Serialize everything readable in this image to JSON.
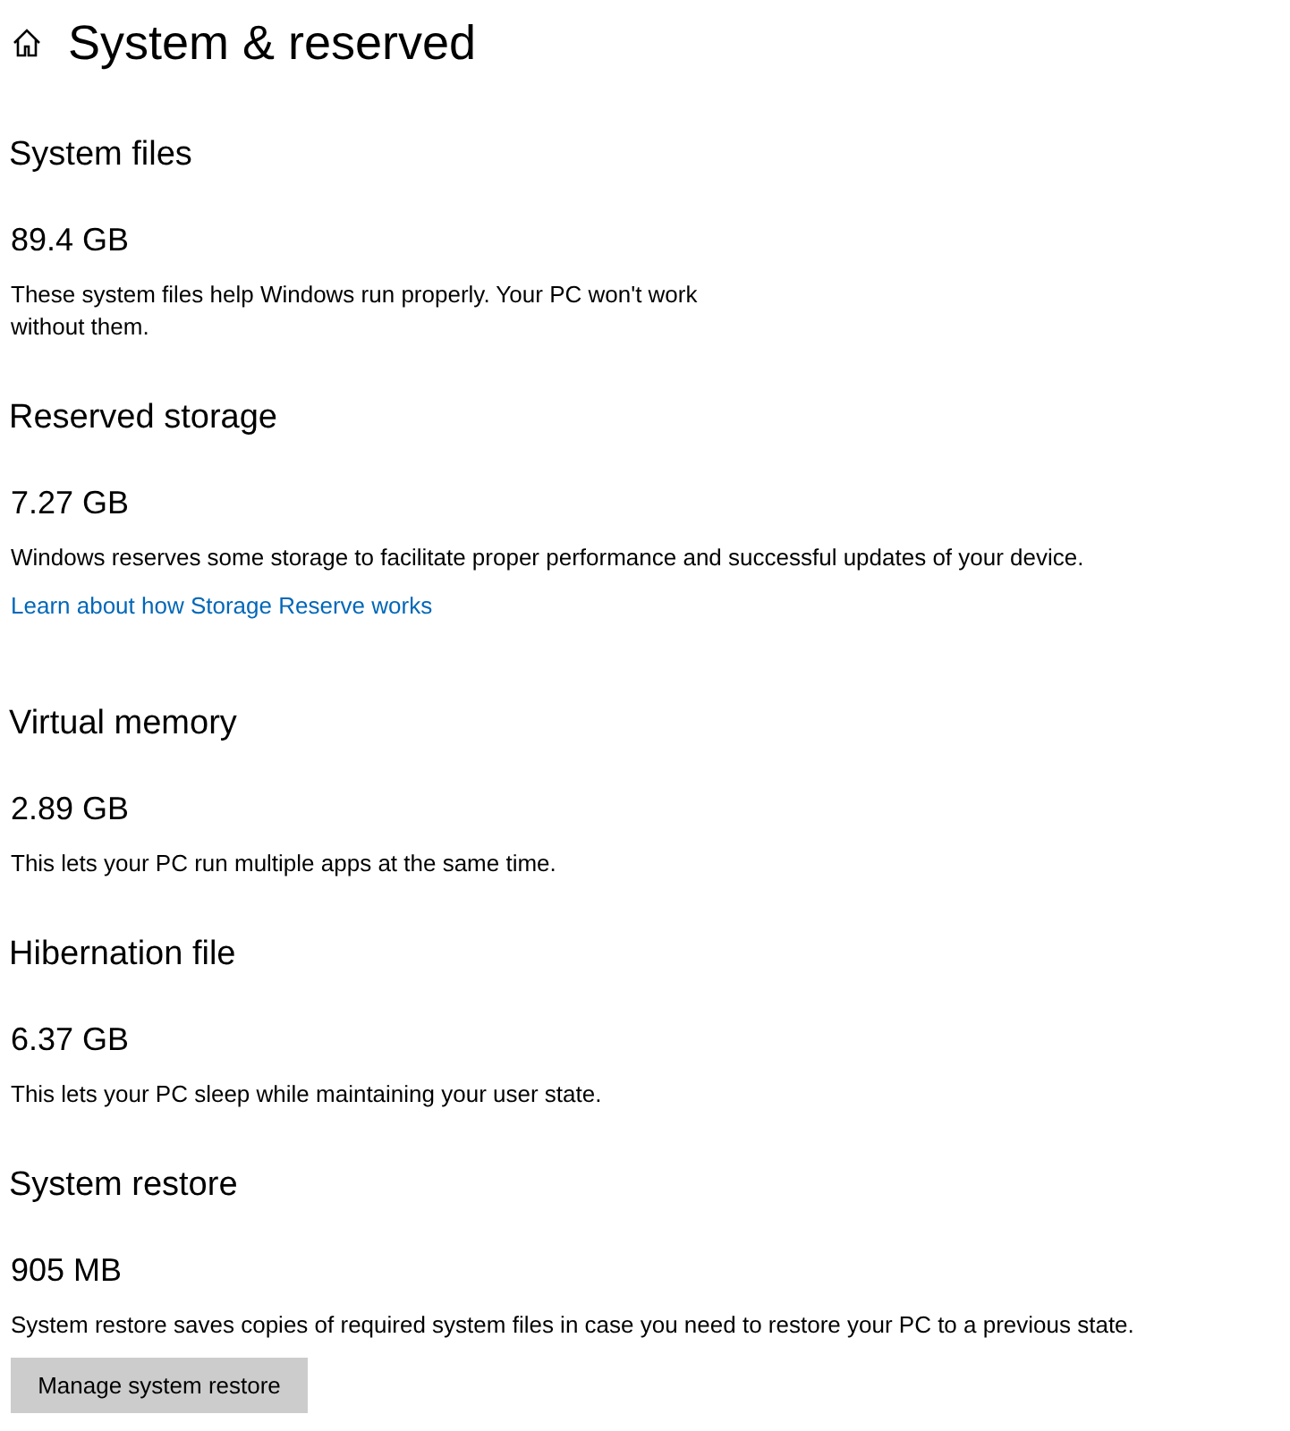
{
  "header": {
    "title": "System & reserved"
  },
  "sections": [
    {
      "heading": "System files",
      "size": "89.4 GB",
      "description": [
        "These system files help Windows run properly. Your PC won't work",
        "without them."
      ]
    },
    {
      "heading": "Reserved storage",
      "size": "7.27 GB",
      "description": [
        "Windows reserves some storage to facilitate proper performance and successful updates of your device."
      ],
      "link": "Learn about how Storage Reserve works"
    },
    {
      "heading": "Virtual memory",
      "size": "2.89 GB",
      "description": [
        "This lets your PC run multiple apps at the same time."
      ]
    },
    {
      "heading": "Hibernation file",
      "size": "6.37 GB",
      "description": [
        "This lets your PC sleep while maintaining your user state."
      ]
    },
    {
      "heading": "System restore",
      "size": "905 MB",
      "description": [
        "System restore saves copies of required system files in case you need to restore your PC to a previous state."
      ],
      "button": "Manage system restore"
    }
  ]
}
